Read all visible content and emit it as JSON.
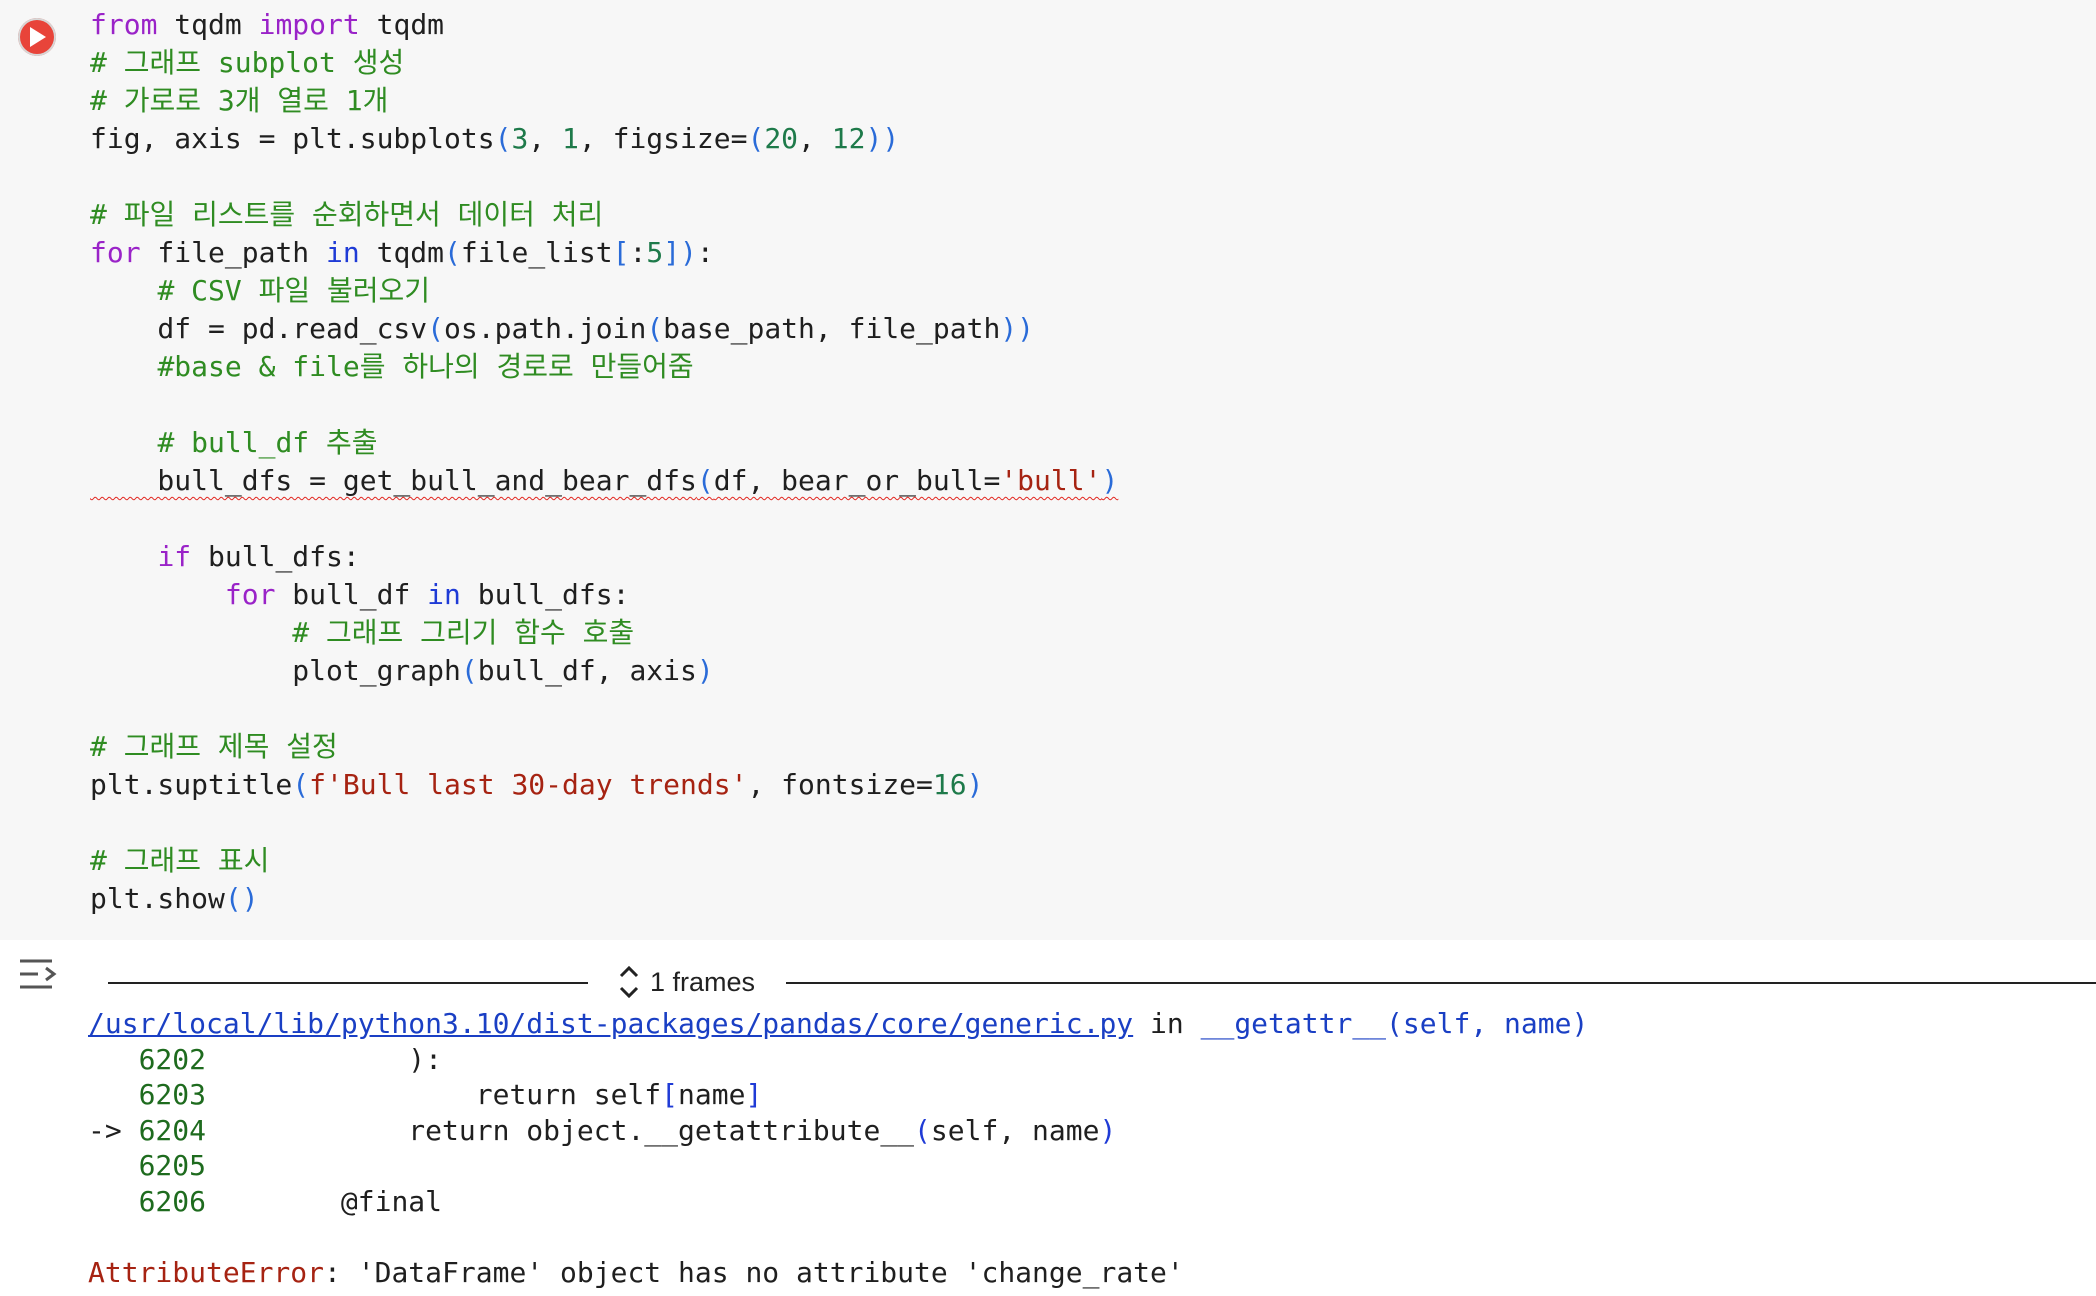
{
  "cell": {
    "run_button_label": "",
    "lines": [
      [
        {
          "t": "from",
          "c": "kw"
        },
        {
          "t": " tqdm "
        },
        {
          "t": "import",
          "c": "kw"
        },
        {
          "t": " tqdm"
        }
      ],
      [
        {
          "t": "# 그래프 subplot 생성",
          "c": "cm"
        }
      ],
      [
        {
          "t": "# 가로로 3개 열로 1개",
          "c": "cm"
        }
      ],
      [
        {
          "t": "fig, axis = plt.subplots"
        },
        {
          "t": "(",
          "c": "pn"
        },
        {
          "t": "3",
          "c": "num"
        },
        {
          "t": ", "
        },
        {
          "t": "1",
          "c": "num"
        },
        {
          "t": ", figsize="
        },
        {
          "t": "(",
          "c": "pn"
        },
        {
          "t": "20",
          "c": "num"
        },
        {
          "t": ", "
        },
        {
          "t": "12",
          "c": "num"
        },
        {
          "t": "))",
          "c": "pn"
        }
      ],
      [],
      [
        {
          "t": "# 파일 리스트를 순회하면서 데이터 처리",
          "c": "cm"
        }
      ],
      [
        {
          "t": "for",
          "c": "kw"
        },
        {
          "t": " file_path "
        },
        {
          "t": "in",
          "c": "kwb"
        },
        {
          "t": " tqdm"
        },
        {
          "t": "(",
          "c": "pn"
        },
        {
          "t": "file_list"
        },
        {
          "t": "[",
          "c": "pn"
        },
        {
          "t": ":"
        },
        {
          "t": "5",
          "c": "num"
        },
        {
          "t": "])",
          "c": "pn"
        },
        {
          "t": ":"
        }
      ],
      [
        {
          "t": "    "
        },
        {
          "t": "# CSV 파일 불러오기",
          "c": "cm"
        }
      ],
      [
        {
          "t": "    df = pd.read_csv"
        },
        {
          "t": "(",
          "c": "pn"
        },
        {
          "t": "os.path.join"
        },
        {
          "t": "(",
          "c": "pn"
        },
        {
          "t": "base_path, file_path"
        },
        {
          "t": "))",
          "c": "pn"
        }
      ],
      [
        {
          "t": "    "
        },
        {
          "t": "#base & file를 하나의 경로로 만들어줌",
          "c": "cm"
        }
      ],
      [],
      [
        {
          "t": "    "
        },
        {
          "t": "# bull_df 추출",
          "c": "cm"
        }
      ],
      [
        {
          "t": "    bull_dfs = get_bull_and_bear_dfs",
          "sq": true
        },
        {
          "t": "(",
          "c": "pn",
          "sq": true
        },
        {
          "t": "df, bear_or_bull=",
          "sq": true
        },
        {
          "t": "'bull'",
          "c": "str",
          "sq": true
        },
        {
          "t": ")",
          "c": "pn",
          "sq": true
        }
      ],
      [],
      [
        {
          "t": "    "
        },
        {
          "t": "if",
          "c": "kw"
        },
        {
          "t": " bull_dfs:"
        }
      ],
      [
        {
          "t": "        "
        },
        {
          "t": "for",
          "c": "kw"
        },
        {
          "t": " bull_df "
        },
        {
          "t": "in",
          "c": "kwb"
        },
        {
          "t": " bull_dfs:"
        }
      ],
      [
        {
          "t": "            "
        },
        {
          "t": "# 그래프 그리기 함수 호출",
          "c": "cm"
        }
      ],
      [
        {
          "t": "            plot_graph"
        },
        {
          "t": "(",
          "c": "pn"
        },
        {
          "t": "bull_df, axis"
        },
        {
          "t": ")",
          "c": "pn"
        }
      ],
      [],
      [
        {
          "t": "# 그래프 제목 설정",
          "c": "cm"
        }
      ],
      [
        {
          "t": "plt.suptitle"
        },
        {
          "t": "(",
          "c": "pn"
        },
        {
          "t": "f'Bull last 30-day trends'",
          "c": "str"
        },
        {
          "t": ", fontsize="
        },
        {
          "t": "16",
          "c": "num"
        },
        {
          "t": ")",
          "c": "pn"
        }
      ],
      [],
      [
        {
          "t": "# 그래프 표시",
          "c": "cm"
        }
      ],
      [
        {
          "t": "plt.show"
        },
        {
          "t": "()",
          "c": "pn"
        }
      ]
    ]
  },
  "output": {
    "frames_label": "1 frames",
    "traceback": {
      "file_link": "/usr/local/lib/python3.10/dist-packages/pandas/core/generic.py",
      "in_word": " in ",
      "func_name": "__getattr__",
      "func_args": "(self, name)",
      "lines": [
        {
          "arrow": "   ",
          "no": "6202",
          "code": "            ):"
        },
        {
          "arrow": "   ",
          "no": "6203",
          "code": "                return self",
          "tail_paren": "[",
          "tail": "name",
          "tail_close": "]"
        },
        {
          "arrow": "-> ",
          "no": "6204",
          "code": "            return object.__getattribute__",
          "tail_paren": "(",
          "tail": "self, name",
          "tail_close": ")"
        },
        {
          "arrow": "   ",
          "no": "6205",
          "code": ""
        },
        {
          "arrow": "   ",
          "no": "6206",
          "code": "        @final"
        }
      ],
      "error_type": "AttributeError",
      "error_message": ": 'DataFrame' object has no attribute 'change_rate'"
    }
  }
}
